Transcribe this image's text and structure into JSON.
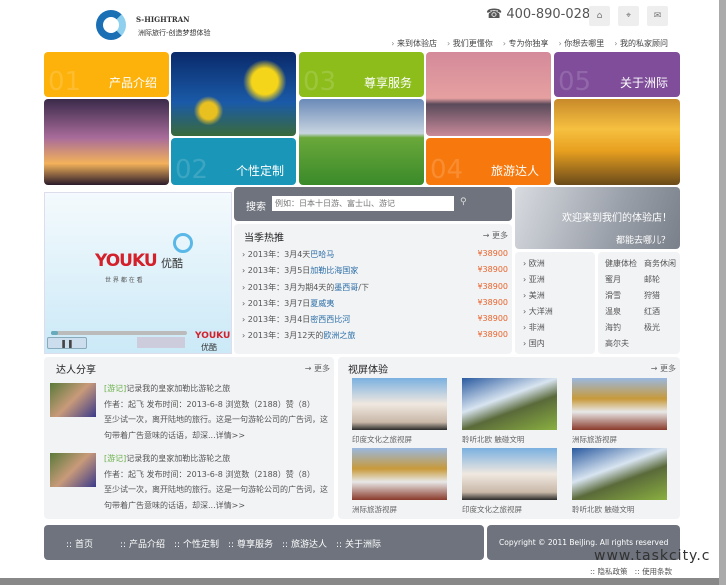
{
  "header": {
    "brand": "S-HIGHTRAN",
    "slogan": "洲际旅行-创造梦想体验",
    "phone": "400-890-0288",
    "icons": [
      "home-icon",
      "location-icon",
      "mail-icon"
    ],
    "nav": [
      "来到体验店",
      "我们更懂你",
      "专为你独享",
      "你想去哪里",
      "我的私家顾问"
    ]
  },
  "tiles": [
    {
      "num": "01",
      "label": "产品介绍",
      "color": "#fdb20b"
    },
    {
      "num": "02",
      "label": "个性定制",
      "color": "#1a96b8"
    },
    {
      "num": "03",
      "label": "尊享服务",
      "color": "#8cbd1b"
    },
    {
      "num": "04",
      "label": "旅游达人",
      "color": "#f7790d"
    },
    {
      "num": "05",
      "label": "关于洲际",
      "color": "#7f4d9a"
    }
  ],
  "video": {
    "logo": "YOUKU",
    "logo_cn": "优酷",
    "tagline": "世 界 都 在 看",
    "progress": 0.05
  },
  "search": {
    "label": "搜索",
    "placeholder": "例如：日本十日游、富士山、游记"
  },
  "hot": {
    "title": "当季热推",
    "more": "更多",
    "items": [
      {
        "pre": "2013年：3月4天",
        "link": "巴哈马",
        "post": "",
        "price": "¥38900"
      },
      {
        "pre": "2013年：3月5日",
        "link": "加勒比海国家",
        "post": "",
        "price": "¥38900"
      },
      {
        "pre": "2013年：3月为期4天的",
        "link": "墨西哥",
        "post": "/下",
        "price": "¥38900"
      },
      {
        "pre": "2013年：3月7日",
        "link": "夏威夷",
        "post": "",
        "price": "¥38900"
      },
      {
        "pre": "2013年：3月4日",
        "link": "密西西比河",
        "post": "",
        "price": "¥38900"
      },
      {
        "pre": "2013年：3月12天的",
        "link": "欧洲之旅",
        "post": "",
        "price": "¥38900"
      }
    ]
  },
  "welcome": {
    "line1": "欢迎来到我们的体验店！",
    "line2": "都能去哪儿？"
  },
  "regions": [
    "欧洲",
    "亚洲",
    "美洲",
    "大洋洲",
    "非洲",
    "国内"
  ],
  "themes": [
    "健康体检",
    "商务休闲",
    "蜜月",
    "邮轮",
    "滑雪",
    "狩猎",
    "温泉",
    "红酒",
    "海钓",
    "极光",
    "高尔夫"
  ],
  "share": {
    "title": "达人分享",
    "more": "更多",
    "posts": [
      {
        "tag": "[游记]",
        "title": "记录我的皇家加勒比游轮之旅",
        "meta": "作者：起飞 发布时间：2013-6-8 浏览数（2188）赞（8）",
        "body": "至少试一次，离开陆地的旅行。这是一句游轮公司的广告词，这句带着广告意味的话语，却深...",
        "detail": "详情>>"
      },
      {
        "tag": "[游记]",
        "title": "记录我的皇家加勒比游轮之旅",
        "meta": "作者：起飞 发布时间：2013-6-8 浏览数（2188）赞（8）",
        "body": "至少试一次，离开陆地的旅行。这是一句游轮公司的广告词，这句带着广告意味的话语，却深...",
        "detail": "详情>>"
      }
    ]
  },
  "videos": {
    "title": "视屏体验",
    "more": "更多",
    "items": [
      "印度文化之旅视屏",
      "聆听北欧 触碰文明",
      "洲际旅游视屏",
      "洲际旅游视屏",
      "印度文化之旅视屏",
      "聆听北欧 触碰文明"
    ]
  },
  "footer": {
    "nav": [
      "首页",
      "产品介绍",
      "个性定制",
      "尊享服务",
      "旅游达人",
      "关于洲际"
    ],
    "copyright": "Copyright © 2011 BeiJing. All rights reserved",
    "watermark": "www.taskcity.c",
    "links": [
      "隐私政策",
      "使用条款"
    ]
  }
}
